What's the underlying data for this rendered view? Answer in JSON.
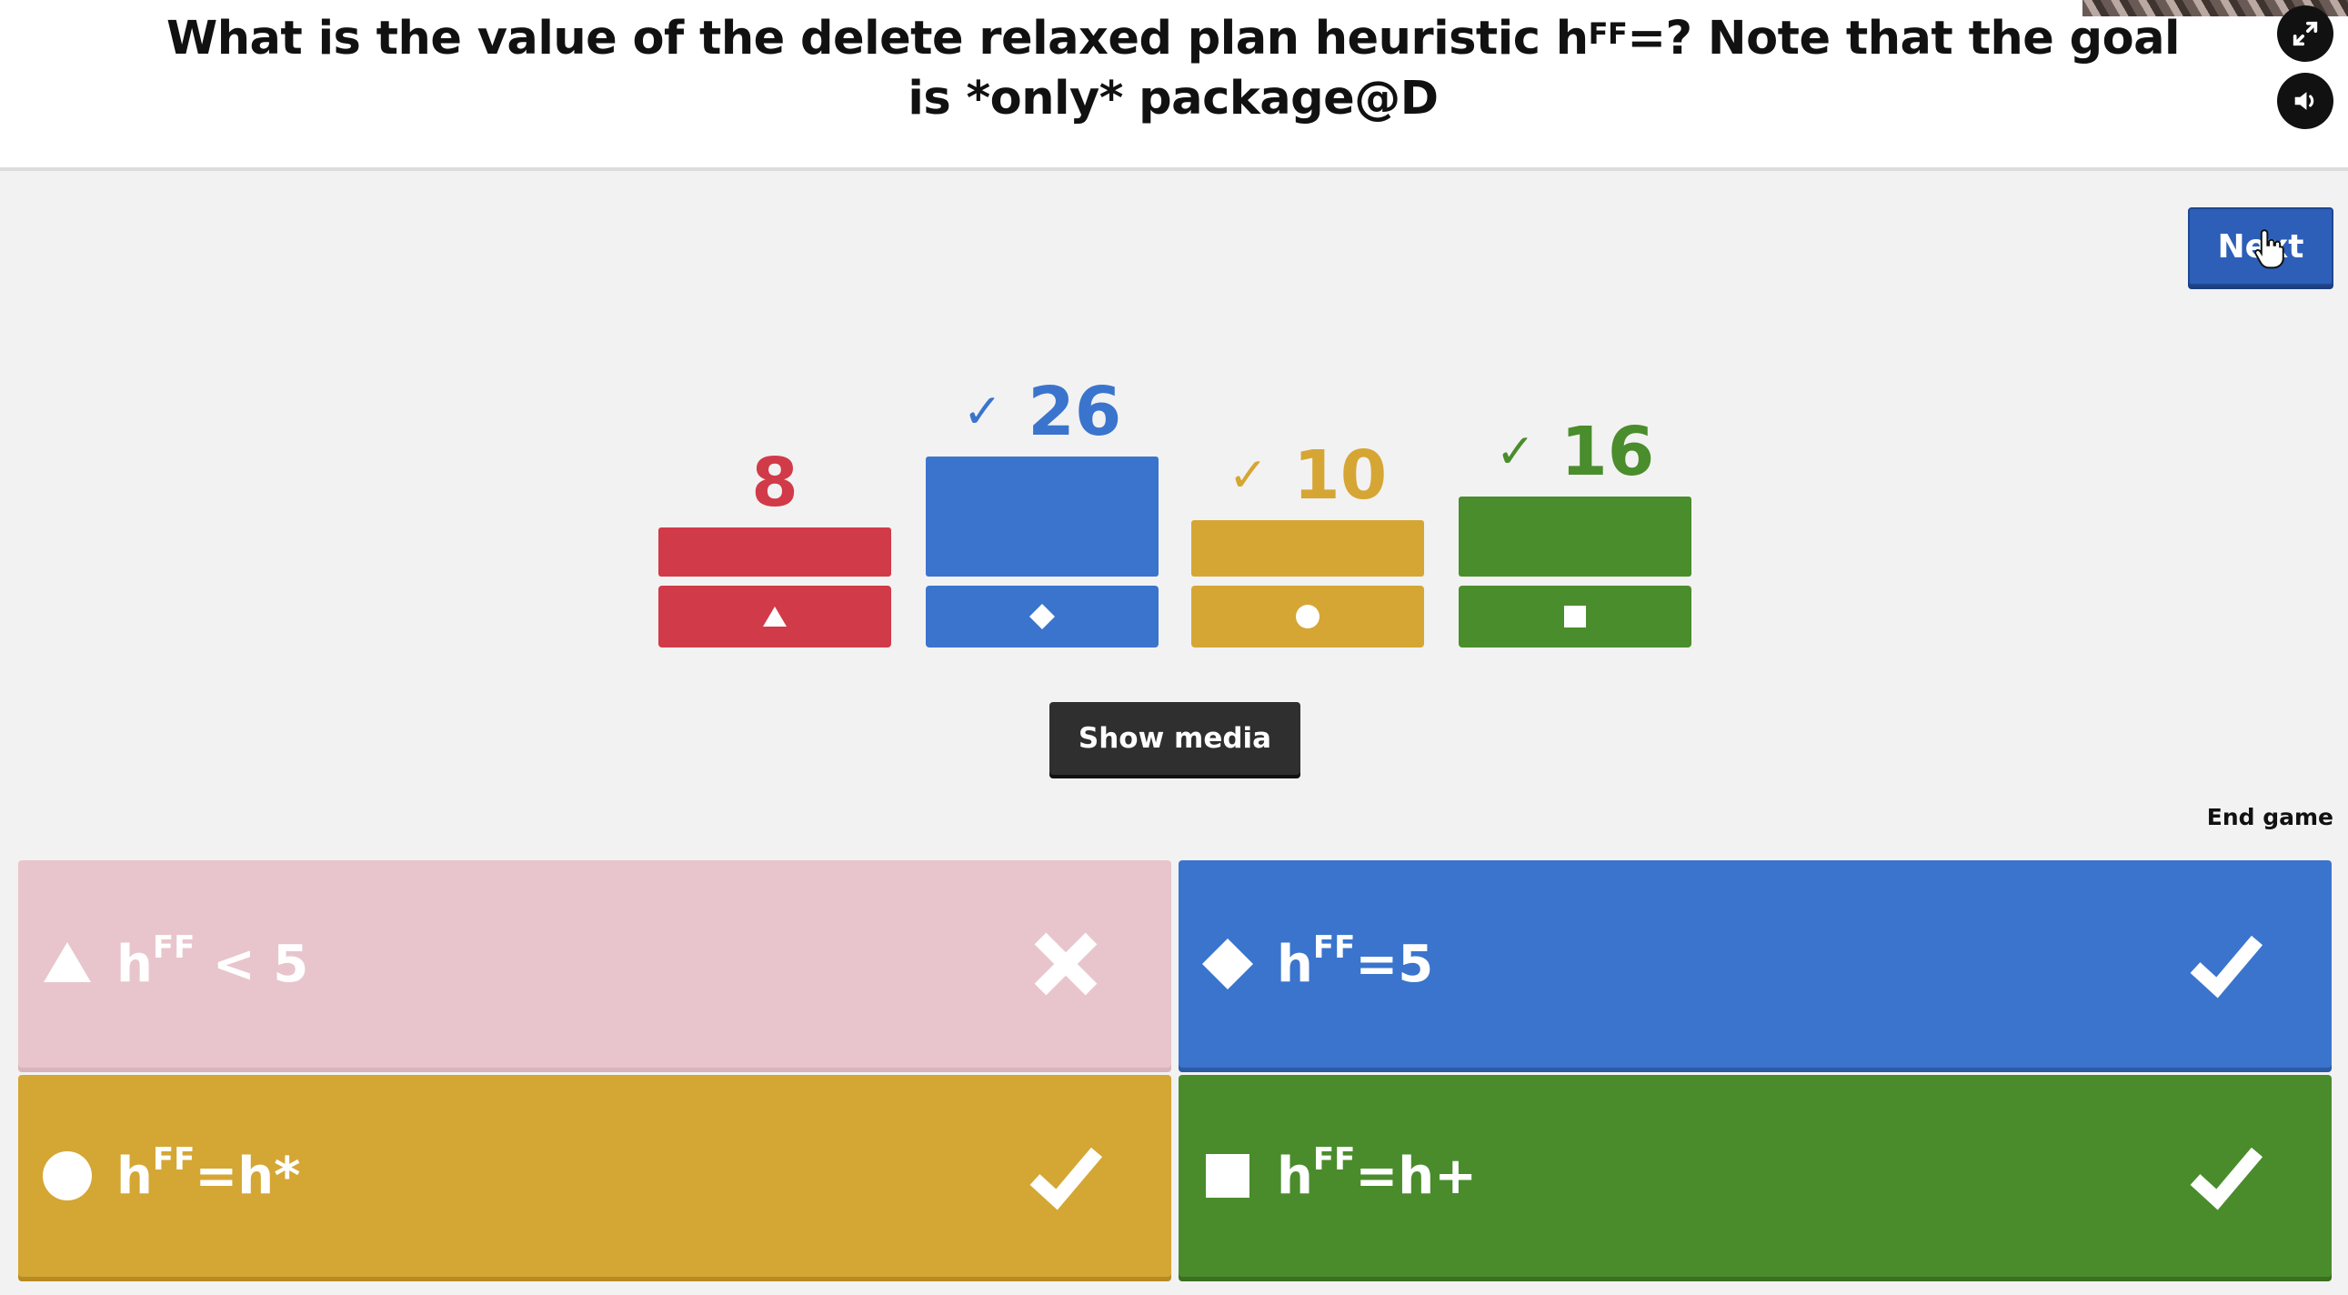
{
  "question": {
    "text_before": "What is the value of the delete relaxed plan heuristic h",
    "sup": "FF",
    "text_after": "=? Note that the goal is *only* package@D"
  },
  "header": {
    "fullscreen_icon": "fullscreen-icon",
    "sound_icon": "speaker-icon"
  },
  "controls": {
    "next_label": "Next",
    "show_media_label": "Show media",
    "end_game_label": "End game"
  },
  "results": [
    {
      "count": "8",
      "correct": false,
      "shape": "triangle",
      "color": "#d13a48"
    },
    {
      "count": "26",
      "correct": true,
      "shape": "diamond",
      "color": "#3a74cd"
    },
    {
      "count": "10",
      "correct": true,
      "shape": "circle",
      "color": "#d6a634"
    },
    {
      "count": "16",
      "correct": true,
      "shape": "square",
      "color": "#4a8d2c"
    }
  ],
  "answers": [
    {
      "base": "h",
      "sup": "FF",
      "rest": " < 5",
      "shape": "triangle",
      "correct": false,
      "color": "#e8c5cc"
    },
    {
      "base": "h",
      "sup": "FF",
      "rest": "=5",
      "shape": "diamond",
      "correct": true,
      "color": "#3a74cd"
    },
    {
      "base": "h",
      "sup": "FF",
      "rest": "=h*",
      "shape": "circle",
      "correct": true,
      "color": "#d4a634"
    },
    {
      "base": "h",
      "sup": "FF",
      "rest": "=h+",
      "shape": "square",
      "correct": true,
      "color": "#4a8c2c"
    }
  ],
  "tick_glyph": "✓"
}
